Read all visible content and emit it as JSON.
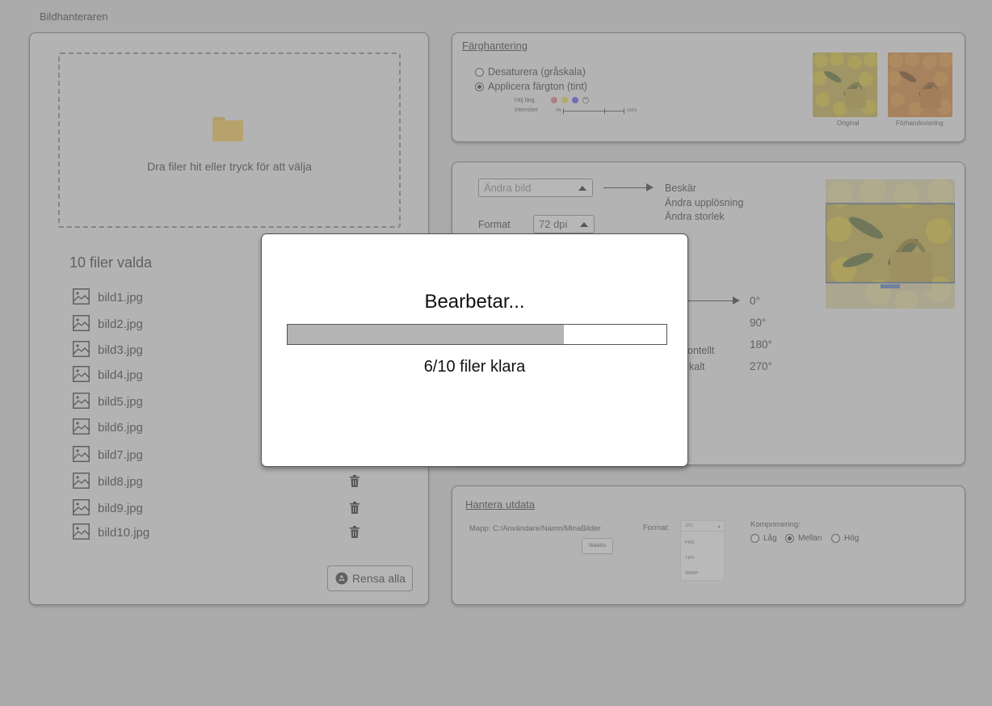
{
  "app": {
    "title": "Bildhanteraren"
  },
  "upload": {
    "drop_text": "Dra filer hit eller tryck för att välja",
    "files_selected": "10 filer valda",
    "files": [
      "bild1.jpg",
      "bild2.jpg",
      "bild3.jpg",
      "bild4.jpg",
      "bild5.jpg",
      "bild6.jpg",
      "bild7.jpg",
      "bild8.jpg",
      "bild9.jpg",
      "bild10.jpg"
    ],
    "clear_label": "Rensa alla"
  },
  "color_panel": {
    "title": "Färghantering",
    "option_desaturate": "Desaturera (gråskala)",
    "option_tint": "Applicera färgton (tint)",
    "selected_option": "tint",
    "choose_color_label": "Välj färg",
    "intensity_label": "Intensitet",
    "intensity_min": "0%",
    "intensity_max": "100%",
    "swatch_colors": [
      "#e8888a",
      "#e8dc6a",
      "#6d6ee8"
    ],
    "original_caption": "Original",
    "preview_caption": "Förhandsvisning"
  },
  "edit_panel": {
    "action_placeholder": "Ändra bild",
    "actions": [
      "Beskär",
      "Ändra upplösning",
      "Ändra storlek"
    ],
    "format_label": "Format",
    "format_value": "72 dpi",
    "flip_partial": [
      "ontellt",
      "kalt"
    ],
    "rotations": [
      "0°",
      "90°",
      "180°",
      "270°"
    ]
  },
  "output_panel": {
    "title": "Hantera utdata",
    "folder_label": "Mapp: C:/Användare/Namn/MinaBilder",
    "browse_label": "Bläddra",
    "format_label": "Format:",
    "format_selected": "JPG",
    "format_options": [
      "PNG",
      "TIFF",
      "WEBP"
    ],
    "compression_label": "Komprimering:",
    "compression_options": [
      "Låg",
      "Mellan",
      "Hög"
    ],
    "compression_selected": "Mellan"
  },
  "processing_modal": {
    "title": "Bearbetar...",
    "status": "6/10 filer klara",
    "progress": 0.73
  }
}
